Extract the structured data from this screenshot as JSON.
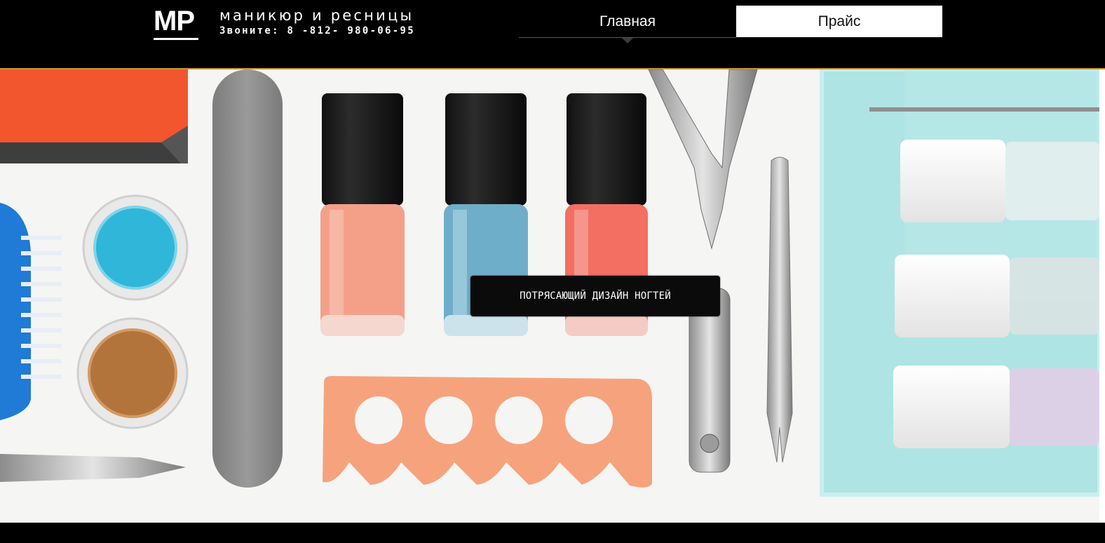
{
  "header": {
    "logo": "MP",
    "tagline": "маникюр и ресницы",
    "phone": "Звоните: 8 -812- 980-06-95"
  },
  "nav": {
    "home": "Главная",
    "price": "Прайс"
  },
  "hero": {
    "caption": "ПОТРЯСАЮЩИЙ ДИЗАЙН НОГТЕЙ"
  },
  "colors": {
    "accent_line": "#c9962f",
    "header_bg": "#000000",
    "nav_active_bg": "#ffffff"
  }
}
